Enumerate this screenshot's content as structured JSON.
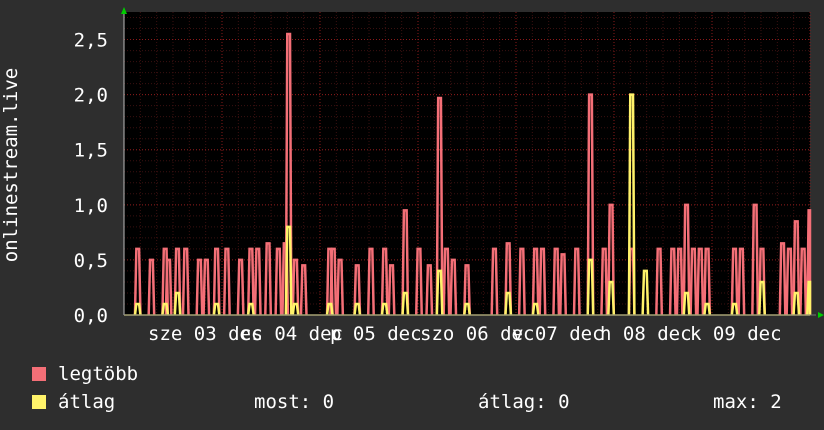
{
  "chart_data": {
    "type": "area",
    "ylabel": "onlinestream.live",
    "ylim": [
      0,
      2.75
    ],
    "y_ticks": [
      "0,0",
      "0,5",
      "1,0",
      "1,5",
      "2,0",
      "2,5"
    ],
    "x_ticks": [
      "sze 03 dec",
      "cs 04 dec",
      "p 05 dec",
      "szo 06 dec",
      "v 07 dec",
      "h 08 dec",
      "k 09 dec"
    ],
    "grid": true,
    "colors": {
      "legtobb": "#f46f77",
      "atlag": "#fff36a",
      "grid": "#8a1a1a",
      "axis": "#bbbbbb"
    },
    "series": [
      {
        "name": "legtöbb",
        "values": [
          [
            0.02,
            0.6
          ],
          [
            0.04,
            0.5
          ],
          [
            0.06,
            0.6
          ],
          [
            0.065,
            0.5
          ],
          [
            0.078,
            0.6
          ],
          [
            0.09,
            0.6
          ],
          [
            0.11,
            0.5
          ],
          [
            0.12,
            0.5
          ],
          [
            0.135,
            0.6
          ],
          [
            0.15,
            0.6
          ],
          [
            0.17,
            0.5
          ],
          [
            0.185,
            0.6
          ],
          [
            0.195,
            0.6
          ],
          [
            0.21,
            0.65
          ],
          [
            0.225,
            0.6
          ],
          [
            0.235,
            0.65
          ],
          [
            0.24,
            2.55
          ],
          [
            0.25,
            0.5
          ],
          [
            0.262,
            0.45
          ],
          [
            0.3,
            0.6
          ],
          [
            0.305,
            0.6
          ],
          [
            0.315,
            0.5
          ],
          [
            0.34,
            0.45
          ],
          [
            0.36,
            0.6
          ],
          [
            0.38,
            0.6
          ],
          [
            0.39,
            0.45
          ],
          [
            0.41,
            0.95
          ],
          [
            0.43,
            0.6
          ],
          [
            0.445,
            0.45
          ],
          [
            0.46,
            1.97
          ],
          [
            0.47,
            0.6
          ],
          [
            0.48,
            0.5
          ],
          [
            0.5,
            0.45
          ],
          [
            0.54,
            0.6
          ],
          [
            0.56,
            0.65
          ],
          [
            0.58,
            0.6
          ],
          [
            0.6,
            0.6
          ],
          [
            0.61,
            0.6
          ],
          [
            0.63,
            0.6
          ],
          [
            0.64,
            0.55
          ],
          [
            0.66,
            0.6
          ],
          [
            0.68,
            2.0
          ],
          [
            0.7,
            0.6
          ],
          [
            0.71,
            1.0
          ],
          [
            0.74,
            0.6
          ],
          [
            0.78,
            0.6
          ],
          [
            0.8,
            0.6
          ],
          [
            0.81,
            0.6
          ],
          [
            0.82,
            1.0
          ],
          [
            0.83,
            0.6
          ],
          [
            0.84,
            0.6
          ],
          [
            0.85,
            0.6
          ],
          [
            0.89,
            0.6
          ],
          [
            0.9,
            0.6
          ],
          [
            0.92,
            1.0
          ],
          [
            0.93,
            0.6
          ],
          [
            0.96,
            0.65
          ],
          [
            0.97,
            0.6
          ],
          [
            0.98,
            0.85
          ],
          [
            0.99,
            0.6
          ],
          [
            1.0,
            0.95
          ]
        ]
      },
      {
        "name": "átlag",
        "values": [
          [
            0.02,
            0.1
          ],
          [
            0.06,
            0.1
          ],
          [
            0.078,
            0.2
          ],
          [
            0.135,
            0.1
          ],
          [
            0.185,
            0.1
          ],
          [
            0.24,
            0.8
          ],
          [
            0.25,
            0.1
          ],
          [
            0.3,
            0.1
          ],
          [
            0.34,
            0.1
          ],
          [
            0.38,
            0.1
          ],
          [
            0.41,
            0.2
          ],
          [
            0.46,
            0.4
          ],
          [
            0.5,
            0.1
          ],
          [
            0.56,
            0.2
          ],
          [
            0.6,
            0.1
          ],
          [
            0.68,
            0.5
          ],
          [
            0.71,
            0.3
          ],
          [
            0.74,
            2.0
          ],
          [
            0.76,
            0.4
          ],
          [
            0.82,
            0.2
          ],
          [
            0.85,
            0.1
          ],
          [
            0.89,
            0.1
          ],
          [
            0.93,
            0.3
          ],
          [
            0.98,
            0.2
          ],
          [
            1.0,
            0.3
          ]
        ]
      }
    ]
  },
  "legend": {
    "legtobb": "legtöbb",
    "atlag": "átlag"
  },
  "stats": {
    "most": "most: 0",
    "atlag": "átlag: 0",
    "max": "max: 2"
  }
}
